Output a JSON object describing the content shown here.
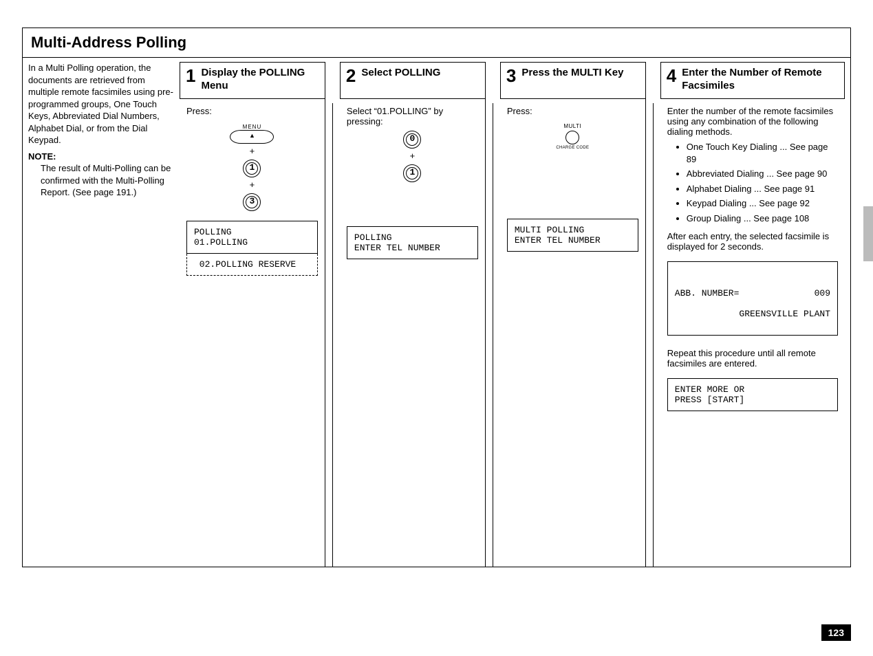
{
  "page_number": "123",
  "section_title": "Multi-Address  Polling",
  "intro": {
    "text": "In a Multi Polling operation, the documents are retrieved from multiple remote facsimiles using pre-programmed groups, One Touch Keys, Abbreviated Dial Numbers, Alphabet Dial, or from the Dial Keypad.",
    "note_heading": "NOTE:",
    "note_text": "The result of Multi-Polling can be confirmed with the Multi-Polling Report. (See page 191.)"
  },
  "steps": [
    {
      "num": "1",
      "title": "Display the POLLING Menu",
      "press_label": "Press:",
      "menu_label": "MENU",
      "keys": [
        "1",
        "3"
      ],
      "lcd_top": "POLLING\n01.POLLING",
      "lcd_bottom": " 02.POLLING RESERVE"
    },
    {
      "num": "2",
      "title": "Select POLLING",
      "instruction": "Select “01.POLLING” by pressing:",
      "keys": [
        "0",
        "1"
      ],
      "lcd": "POLLING\nENTER TEL NUMBER"
    },
    {
      "num": "3",
      "title": "Press the MULTI Key",
      "press_label": "Press:",
      "multi_label_top": "MULTI",
      "multi_label_bottom": "CHARGE CODE",
      "lcd": "MULTI POLLING\nENTER TEL NUMBER"
    },
    {
      "num": "4",
      "title": "Enter the Number of Remote Facsimiles",
      "intro_text": "Enter the number of the remote facsimiles using any combination of the following dialing methods.",
      "bullets": [
        "One Touch Key Dialing ... See page 89",
        "Abbreviated Dialing ... See page 90",
        "Alphabet Dialing ... See page 91",
        "Keypad Dialing ... See page 92",
        "Group Dialing ... See page 108"
      ],
      "after_text": "After each entry, the selected facsimile is displayed for 2 seconds.",
      "lcd1_left": "ABB. NUMBER=",
      "lcd1_right": "009",
      "lcd1_line2": "GREENSVILLE PLANT",
      "repeat_text": "Repeat this procedure until all remote facsimiles are entered.",
      "lcd2": "ENTER MORE OR\nPRESS [START]"
    }
  ]
}
